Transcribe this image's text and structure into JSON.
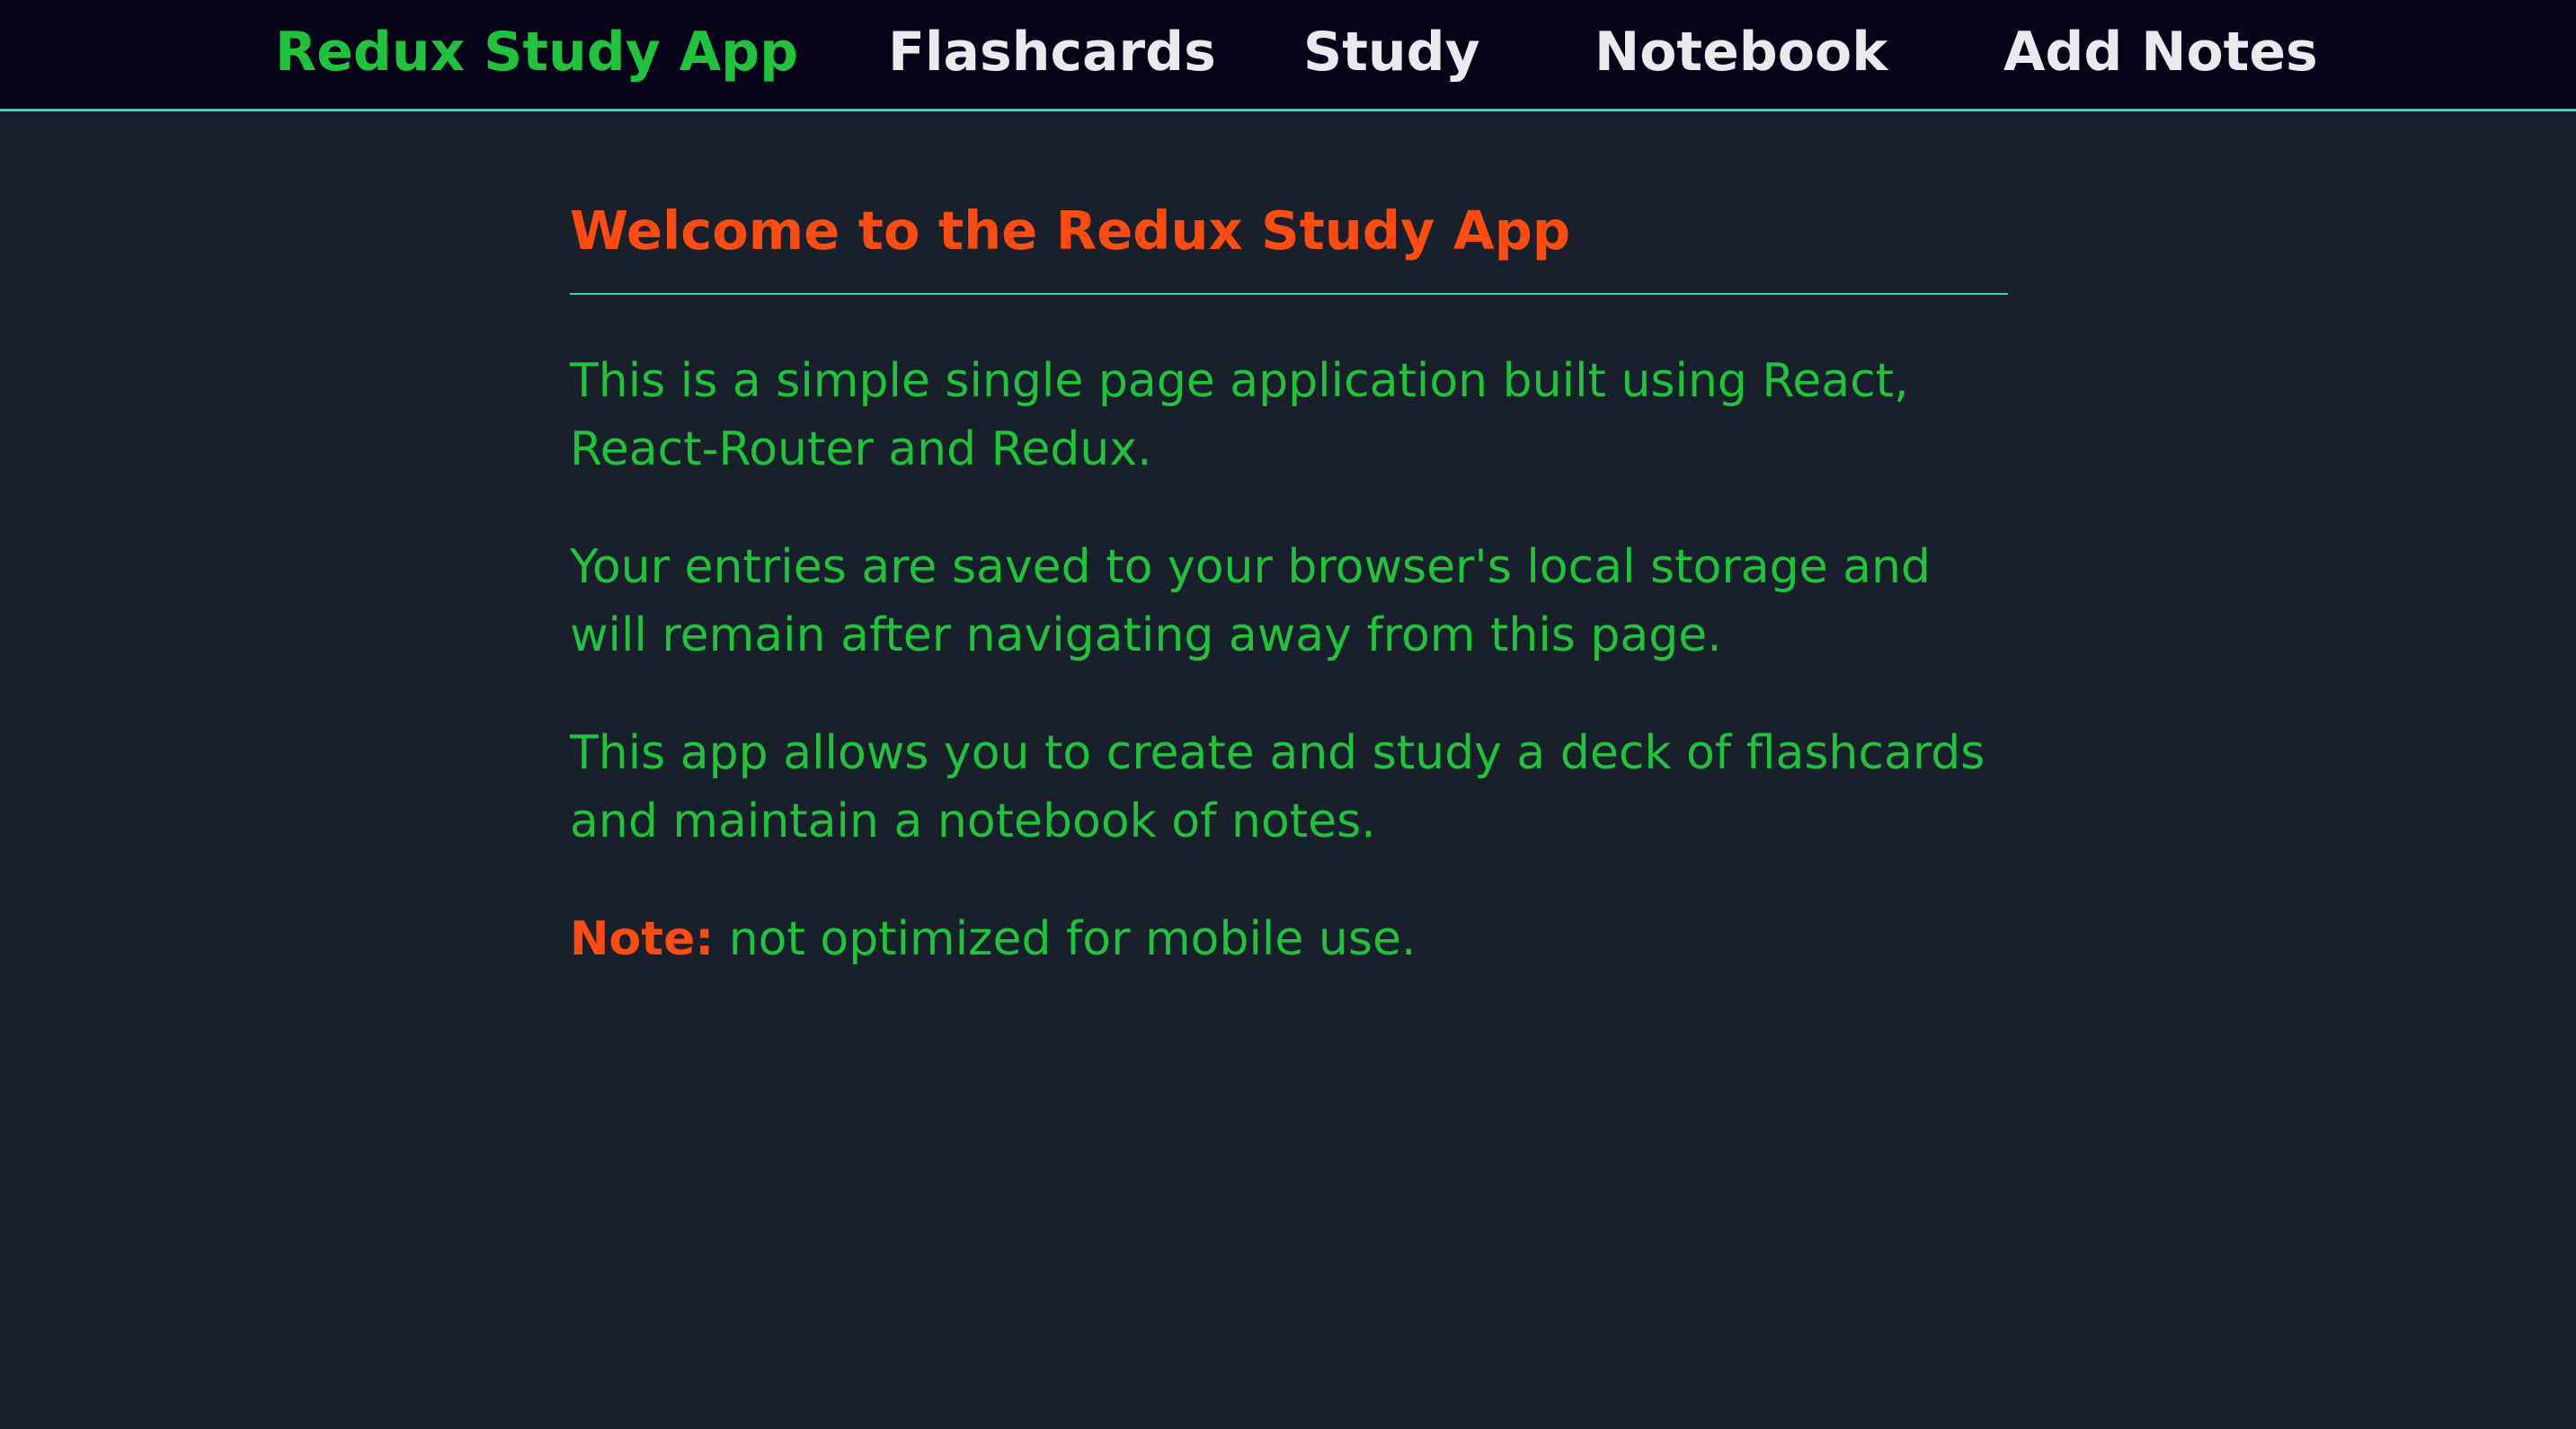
{
  "nav": {
    "brand": "Redux Study App",
    "items": [
      {
        "label": "Flashcards"
      },
      {
        "label": "Study"
      },
      {
        "label": "Notebook"
      },
      {
        "label": "Add Notes"
      }
    ]
  },
  "main": {
    "title": "Welcome to the Redux Study App",
    "paragraphs": [
      "This is a simple single page application built using React, React-Router and Redux.",
      "Your entries are saved to your browser's local storage and will remain after navigating away from this page.",
      "This app allows you to create and study a deck of flashcards and maintain a notebook of notes."
    ],
    "note": {
      "label": "Note:",
      "text": " not optimized for mobile use."
    }
  },
  "colors": {
    "background": "#18212b",
    "navbar": "#060318",
    "accent_line": "#3fd1b4",
    "brand_green": "#1fc43a",
    "heading_orange": "#fe4b0f",
    "nav_text": "#e9e9ee"
  }
}
